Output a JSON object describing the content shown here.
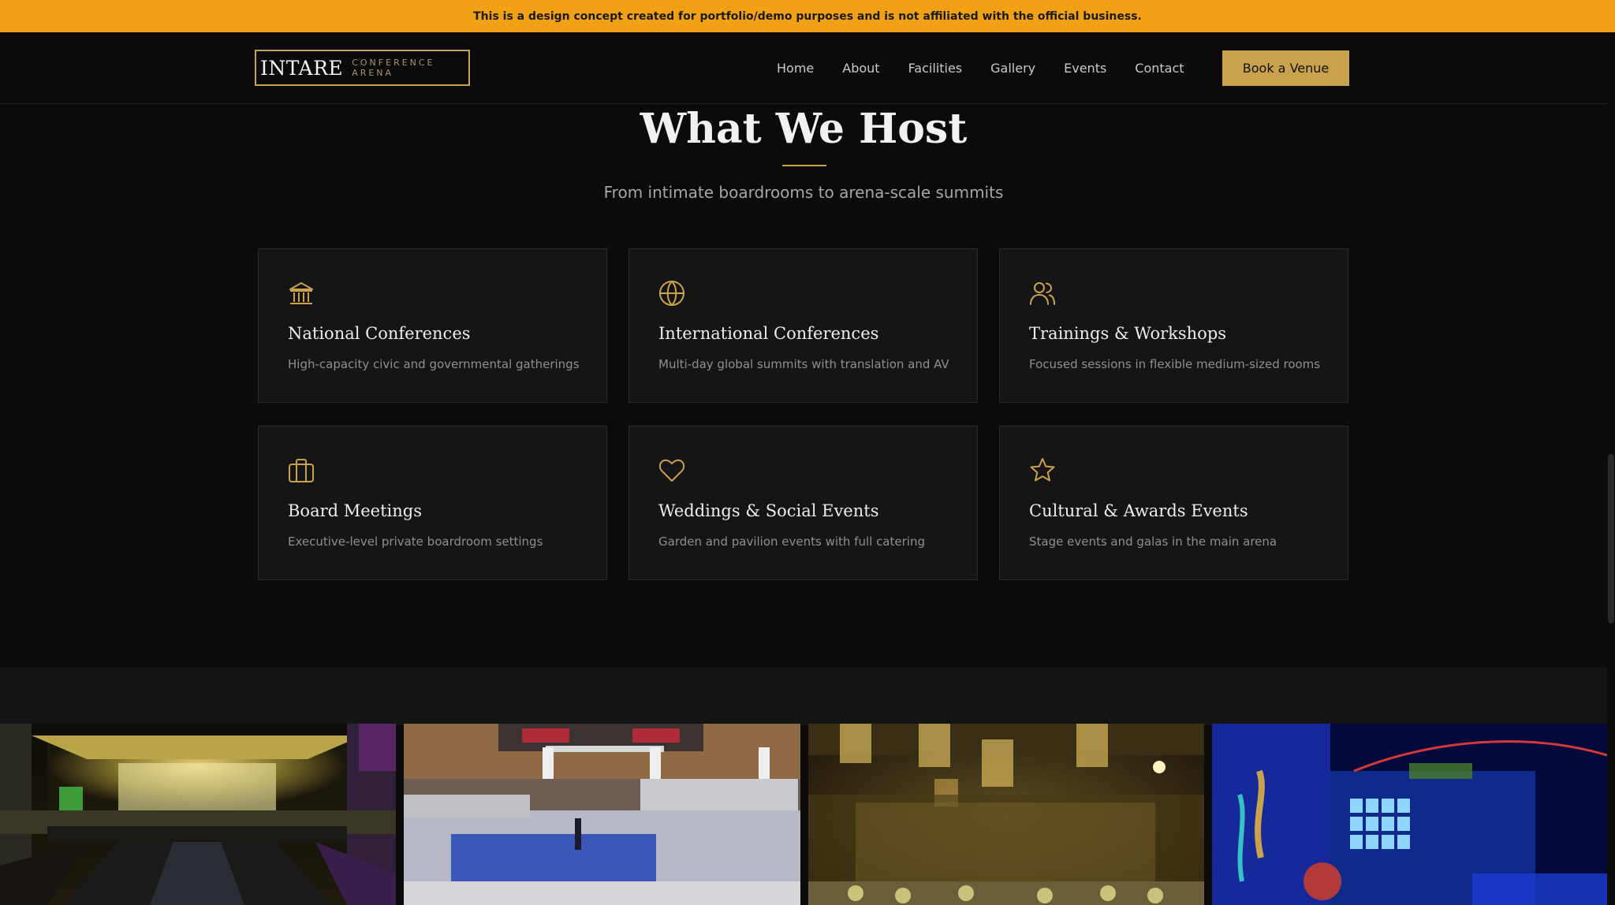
{
  "banner": {
    "text": "This is a design concept created for portfolio/demo purposes and is not affiliated with the official business."
  },
  "nav": {
    "logo_main": "INTARE",
    "logo_sub": "CONFERENCE ARENA",
    "links": [
      "Home",
      "About",
      "Facilities",
      "Gallery",
      "Events",
      "Contact"
    ],
    "cta_label": "Book a Venue"
  },
  "section": {
    "title": "What We Host",
    "subtitle": "From intimate boardrooms to arena-scale summits"
  },
  "cards": [
    {
      "icon": "landmark-icon",
      "title": "National Conferences",
      "description": "High-capacity civic and governmental gatherings"
    },
    {
      "icon": "globe-icon",
      "title": "International Conferences",
      "description": "Multi-day global summits with translation and AV"
    },
    {
      "icon": "users-icon",
      "title": "Trainings & Workshops",
      "description": "Focused sessions in flexible medium-sized rooms"
    },
    {
      "icon": "briefcase-icon",
      "title": "Board Meetings",
      "description": "Executive-level private boardroom settings"
    },
    {
      "icon": "heart-icon",
      "title": "Weddings & Social Events",
      "description": "Garden and pavilion events with full catering"
    },
    {
      "icon": "star-icon",
      "title": "Cultural & Awards Events",
      "description": "Stage events and galas in the main arena"
    }
  ],
  "gallery": {
    "items": [
      "venue-entrance-photo",
      "conference-audience-photo",
      "gala-lights-photo",
      "arena-exterior-photo"
    ]
  },
  "colors": {
    "banner": "#f2a114",
    "accent_gold": "#c9a24b",
    "background": "#0b0b0b",
    "card": "#151515"
  }
}
